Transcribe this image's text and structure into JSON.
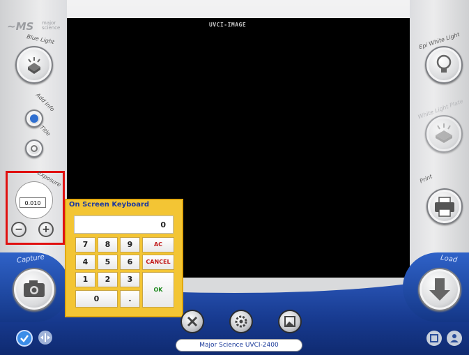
{
  "app": {
    "logo_symbol": "~MS",
    "logo_line1": "major",
    "logo_line2": "science"
  },
  "viewer": {
    "title": "UVCI-IMAGE"
  },
  "left_controls": {
    "blue_light_label": "Blue Light",
    "add_info_label": "Add Info",
    "title_label": "Title",
    "exposure_label": "Exposure",
    "exposure_value": "0.010",
    "minus_label": "−",
    "plus_label": "+",
    "capture_label": "Capture"
  },
  "right_controls": {
    "epi_white_light_label": "Epi White Light",
    "white_light_plate_label": "White Light Plate",
    "print_label": "Print",
    "load_label": "Load"
  },
  "keyboard": {
    "title": "On Screen Keyboard",
    "display_value": "0",
    "keys": {
      "k7": "7",
      "k8": "8",
      "k9": "9",
      "ac": "AC",
      "k4": "4",
      "k5": "5",
      "k6": "6",
      "cancel": "CANCEL",
      "k1": "1",
      "k2": "2",
      "k3": "3",
      "ok": "OK",
      "k0": "0",
      "dot": "."
    }
  },
  "status": {
    "device_name": "Major Science UVCI-2400"
  },
  "icons": {
    "blue_light": "light-box-icon",
    "epi_white": "bulb-icon",
    "white_plate": "plate-icon",
    "print": "printer-icon",
    "capture": "camera-icon",
    "load": "down-arrow-icon",
    "settings": "gear-icon",
    "tools": "tools-icon",
    "image": "image-icon",
    "check": "check-icon",
    "compare": "compare-icon",
    "save": "save-icon",
    "user": "user-icon"
  },
  "colors": {
    "accent": "#1d3a9e",
    "keyboard_bg": "#f3c534",
    "highlight": "#e01010"
  }
}
